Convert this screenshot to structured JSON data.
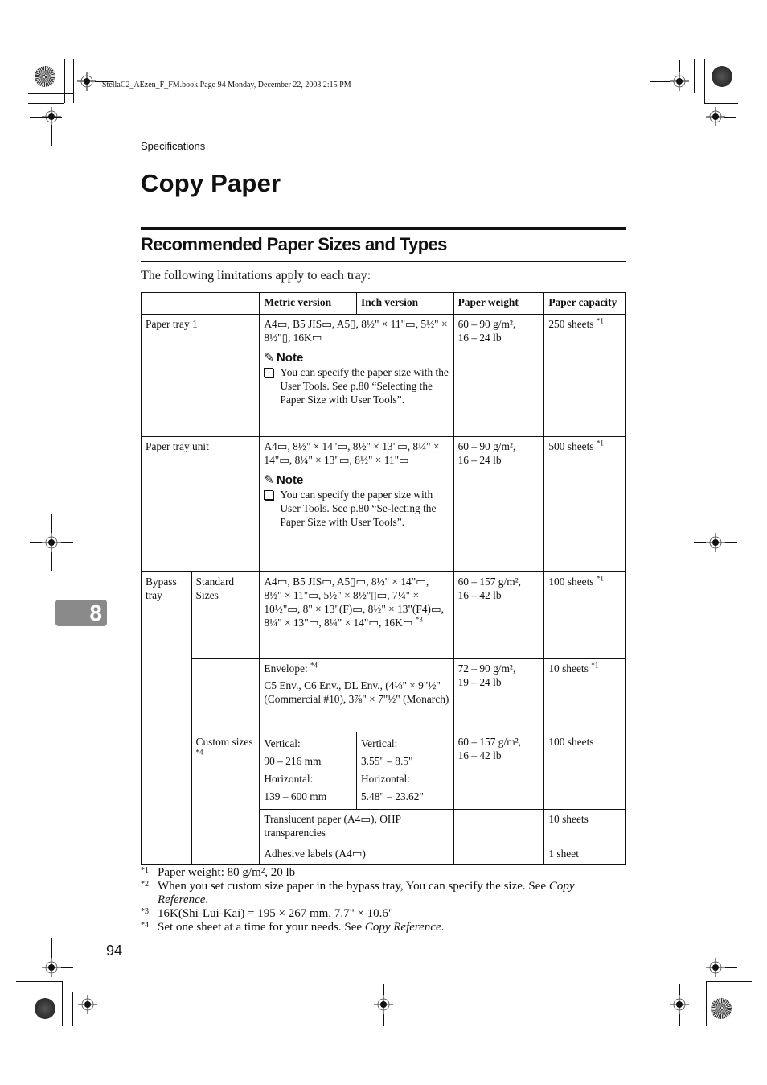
{
  "print_header": {
    "book_line": "StellaC2_AEzen_F_FM.book  Page 94  Monday, December 22, 2003  2:15 PM"
  },
  "running_head": "Specifications",
  "chapter_tab": "8",
  "title": "Copy Paper",
  "section": {
    "heading": "Recommended Paper Sizes and Types",
    "intro": "The following limitations apply to each tray:"
  },
  "table": {
    "headers": {
      "metric": "Metric version",
      "inch": "Inch version",
      "weight": "Paper weight",
      "capacity": "Paper capacity"
    },
    "rows": {
      "tray1": {
        "label": "Paper tray 1",
        "sizes": "A4▭, B5 JIS▭, A5▯, 8½\" × 11\"▭, 5½\" × 8½\"▯, 16K▭",
        "note_title": "Note",
        "note_text": "You can specify the paper size with the User Tools. See p.80 “Selecting the Paper Size with User Tools”.",
        "weight_line1": "60 – 90 g/m²,",
        "weight_line2": "16 – 24 lb",
        "capacity": "250 sheets",
        "capacity_ref": "*1"
      },
      "tray_unit": {
        "label": "Paper tray unit",
        "sizes": "A4▭, 8½\" × 14\"▭, 8½\" × 13\"▭, 8¼\" × 14\"▭, 8¼\" × 13\"▭, 8½\" × 11\"▭",
        "note_title": "Note",
        "note_text": "You can specify the paper size with User Tools. See p.80 “Se-lecting the Paper Size with User Tools”.",
        "weight_line1": "60 – 90 g/m²,",
        "weight_line2": "16 – 24 lb",
        "capacity": "500 sheets",
        "capacity_ref": "*1"
      },
      "bypass": {
        "label": "Bypass tray",
        "standard": {
          "label": "Standard Sizes",
          "sizes": "A4▭, B5 JIS▭, A5▯▭, 8½\" × 14\"▭, 8½\" × 11\"▭, 5½\" × 8½\"▯▭, 7¼\" × 10½\"▭, 8\" × 13\"(F)▭, 8½\" × 13\"(F4)▭, 8¼\" × 13\"▭, 8¼\" × 14\"▭, 16K▭",
          "sizes_ref": "*3",
          "weight_line1": "60 – 157 g/m²,",
          "weight_line2": "16 – 42 lb",
          "capacity": "100 sheets",
          "capacity_ref": "*1"
        },
        "envelope": {
          "label": "Envelope:",
          "label_ref": "*4",
          "sizes": "C5 Env., C6 Env., DL Env., (4⅛\" × 9\"½\" (Commercial #10), 3⅞\" × 7\"½\" (Monarch)",
          "weight_line1": "72 – 90 g/m²,",
          "weight_line2": "19 – 24 lb",
          "capacity": "10 sheets",
          "capacity_ref": "*1"
        },
        "custom": {
          "label": "Custom sizes",
          "label_ref": "*4",
          "metric_vertical_label": "Vertical:",
          "metric_vertical": "90 – 216 mm",
          "metric_horizontal_label": "Horizontal:",
          "metric_horizontal": "139 – 600 mm",
          "inch_vertical_label": "Vertical:",
          "inch_vertical": "3.55\" – 8.5\"",
          "inch_horizontal_label": "Horizontal:",
          "inch_horizontal": "5.48\" – 23.62\"",
          "weight_line1": "60 – 157 g/m²,",
          "weight_line2": "16 – 42 lb",
          "capacity": "100 sheets"
        },
        "translucent": {
          "label": "Translucent paper (A4▭), OHP transparencies",
          "capacity": "10 sheets"
        },
        "adhesive": {
          "label": "Adhesive labels (A4▭)",
          "capacity": "1 sheet"
        }
      }
    }
  },
  "footnotes": [
    {
      "mark": "*1",
      "text": "Paper weight: 80 g/m², 20 lb"
    },
    {
      "mark": "*2",
      "text": "When you set custom size paper in the bypass tray, You can specify the size. See ",
      "italic": "Copy Reference",
      "after": "."
    },
    {
      "mark": "*3",
      "text": "16K(Shi-Lui-Kai) = 195 × 267 mm, 7.7\" × 10.6\""
    },
    {
      "mark": "*4",
      "text": "Set one sheet at a time for your needs. See ",
      "italic": "Copy Reference",
      "after": "."
    }
  ],
  "page_number": "94",
  "icons": {
    "note": "pencil-icon",
    "paper_orientation": "paper-orientation-icon",
    "registration": "registration-mark-icon"
  }
}
